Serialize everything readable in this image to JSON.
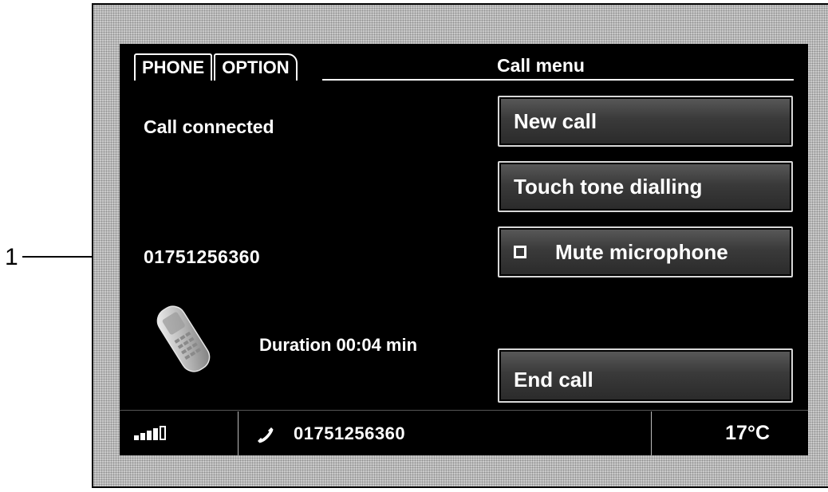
{
  "callout": {
    "label": "1"
  },
  "tabs": [
    {
      "label": "PHONE",
      "active": true
    },
    {
      "label": "OPTION",
      "active": false
    }
  ],
  "menu_title": "Call menu",
  "call": {
    "status": "Call connected",
    "number": "01751256360",
    "duration": "Duration 00:04 min"
  },
  "menu_buttons": {
    "new_call": "New call",
    "touch_tone": "Touch tone dialling",
    "mute": "Mute microphone",
    "end_call": "End call"
  },
  "statusbar": {
    "signal_bars": 4,
    "signal_max": 5,
    "number": "01751256360",
    "temperature": "17°C"
  },
  "icons": {
    "phone_image": "mobile-phone-icon",
    "handset": "handset-icon",
    "signal": "signal-strength-icon",
    "mute_checkbox": "checkbox-icon"
  }
}
